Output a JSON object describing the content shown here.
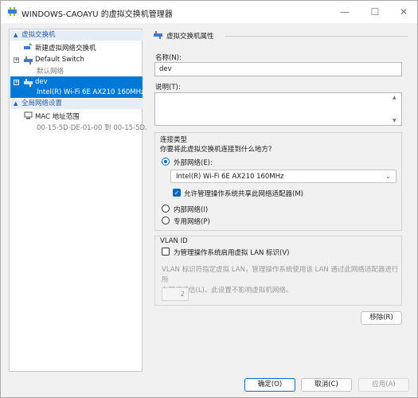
{
  "window": {
    "title": "WINDOWS-CAOAYU 的虚拟交换机管理器"
  },
  "tree": {
    "section_virtual_switches": "虚拟交换机",
    "new_switch": "新建虚拟网络交换机",
    "switches": [
      {
        "name": "Default Switch",
        "detail": "默认网络",
        "selected": false
      },
      {
        "name": "dev",
        "detail": "Intel(R) Wi-Fi 6E AX210 160MHz",
        "selected": true
      }
    ],
    "section_global": "全局网络设置",
    "mac_range_label": "MAC 地址范围",
    "mac_range_value": "00-15-5D-DE-01-00 到 00-15-5D..."
  },
  "properties": {
    "header": "虚拟交换机属性",
    "name_label": "名称(N):",
    "name_value": "dev",
    "notes_label": "说明(T):",
    "notes_value": "",
    "connection_type": {
      "label": "连接类型",
      "question": "你要将此虚拟交换机连接到什么地方?",
      "external_label": "外部网络(E):",
      "external_checked": true,
      "adapter_selected": "Intel(R) Wi-Fi 6E AX210 160MHz",
      "allow_share_label": "允许管理操作系统共享此网络适配器(M)",
      "allow_share_checked": true,
      "internal_label": "内部网络(I)",
      "private_label": "专用网络(P)"
    },
    "vlan": {
      "label": "VLAN ID",
      "enable_label": "为管理操作系统启用虚拟 LAN 标识(V)",
      "enable_checked": false,
      "description_line1": "VLAN 标识符指定虚拟 LAN，管理操作系统使用该 LAN 通过此网络适配器进行所",
      "description_line2": "有网络通信(L)。此设置不影响虚拟机网络。",
      "vlan_value": "2"
    },
    "remove_button": "移除(R)"
  },
  "footer": {
    "ok": "确定(O)",
    "cancel": "取消(C)",
    "apply": "应用(A)"
  },
  "colors": {
    "selection": "#0078d7",
    "accent": "#0067c0",
    "section_bg": "#e6edf6"
  }
}
